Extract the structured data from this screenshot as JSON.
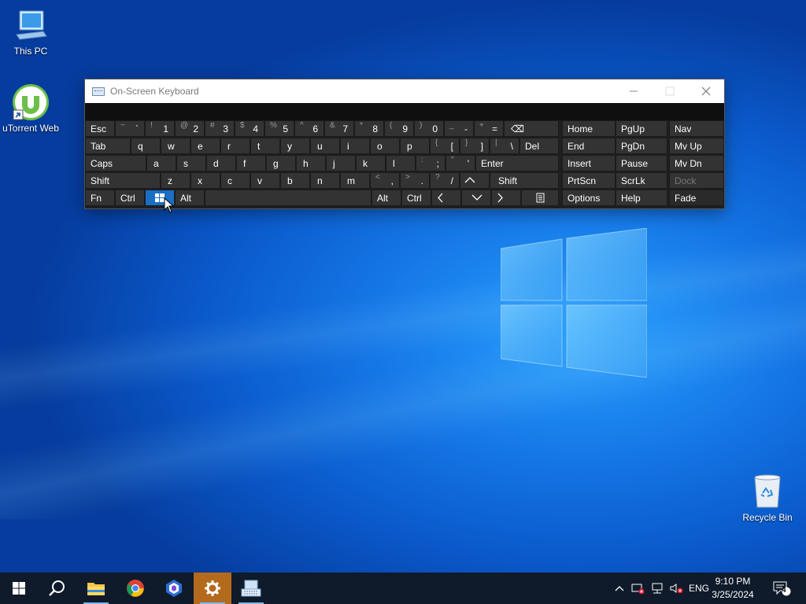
{
  "desktop": {
    "icons": [
      {
        "label": "This PC"
      },
      {
        "label": "uTorrent Web"
      },
      {
        "label": "Recycle Bin"
      }
    ]
  },
  "osk": {
    "title": "On-Screen Keyboard",
    "rows": {
      "r1": [
        {
          "label": "Esc"
        },
        {
          "shift": "~",
          "main": "`"
        },
        {
          "shift": "!",
          "main": "1"
        },
        {
          "shift": "@",
          "main": "2"
        },
        {
          "shift": "#",
          "main": "3"
        },
        {
          "shift": "$",
          "main": "4"
        },
        {
          "shift": "%",
          "main": "5"
        },
        {
          "shift": "^",
          "main": "6"
        },
        {
          "shift": "&",
          "main": "7"
        },
        {
          "shift": "*",
          "main": "8"
        },
        {
          "shift": "(",
          "main": "9"
        },
        {
          "shift": ")",
          "main": "0"
        },
        {
          "shift": "_",
          "main": "-"
        },
        {
          "shift": "+",
          "main": "="
        },
        {
          "label": "⌫"
        }
      ],
      "r2": [
        {
          "label": "Tab"
        },
        {
          "label": "q"
        },
        {
          "label": "w"
        },
        {
          "label": "e"
        },
        {
          "label": "r"
        },
        {
          "label": "t"
        },
        {
          "label": "y"
        },
        {
          "label": "u"
        },
        {
          "label": "i"
        },
        {
          "label": "o"
        },
        {
          "label": "p"
        },
        {
          "shift": "{",
          "main": "["
        },
        {
          "shift": "}",
          "main": "]"
        },
        {
          "shift": "|",
          "main": "\\"
        },
        {
          "label": "Del"
        }
      ],
      "r3": [
        {
          "label": "Caps"
        },
        {
          "label": "a"
        },
        {
          "label": "s"
        },
        {
          "label": "d"
        },
        {
          "label": "f"
        },
        {
          "label": "g"
        },
        {
          "label": "h"
        },
        {
          "label": "j"
        },
        {
          "label": "k"
        },
        {
          "label": "l"
        },
        {
          "shift": ":",
          "main": ";"
        },
        {
          "shift": "\"",
          "main": "'"
        },
        {
          "label": "Enter"
        }
      ],
      "r4": [
        {
          "label": "Shift"
        },
        {
          "label": "z"
        },
        {
          "label": "x"
        },
        {
          "label": "c"
        },
        {
          "label": "v"
        },
        {
          "label": "b"
        },
        {
          "label": "n"
        },
        {
          "label": "m"
        },
        {
          "shift": "<",
          "main": ","
        },
        {
          "shift": ">",
          "main": "."
        },
        {
          "shift": "?",
          "main": "/"
        },
        {
          "label": "^"
        },
        {
          "label": "Shift"
        }
      ],
      "r5": [
        {
          "label": "Fn"
        },
        {
          "label": "Ctrl"
        },
        {
          "label": "⊞"
        },
        {
          "label": "Alt"
        },
        {
          "label": ""
        },
        {
          "label": "Alt"
        },
        {
          "label": "Ctrl"
        },
        {
          "label": "<"
        },
        {
          "label": "v"
        },
        {
          "label": ">"
        },
        {
          "label": "▤"
        }
      ]
    },
    "nav": {
      "home": "Home",
      "pgup": "PgUp",
      "navbtn": "Nav",
      "end": "End",
      "pgdn": "PgDn",
      "mvup": "Mv Up",
      "insert": "Insert",
      "pause": "Pause",
      "mvdn": "Mv Dn",
      "prtscn": "PrtScn",
      "scrlk": "ScrLk",
      "dock": "Dock",
      "options": "Options",
      "help": "Help",
      "fade": "Fade"
    }
  },
  "taskbar": {
    "tray": {
      "language": "ENG",
      "notifications_count": "4"
    },
    "clock": {
      "time": "9:10 PM",
      "date": "3/25/2024"
    }
  },
  "colors": {
    "accent_key": "#1a6ec4",
    "key_bg": "#333333",
    "taskbar_bg": "#0f1a2a",
    "selected_app": "#b46a1c"
  }
}
